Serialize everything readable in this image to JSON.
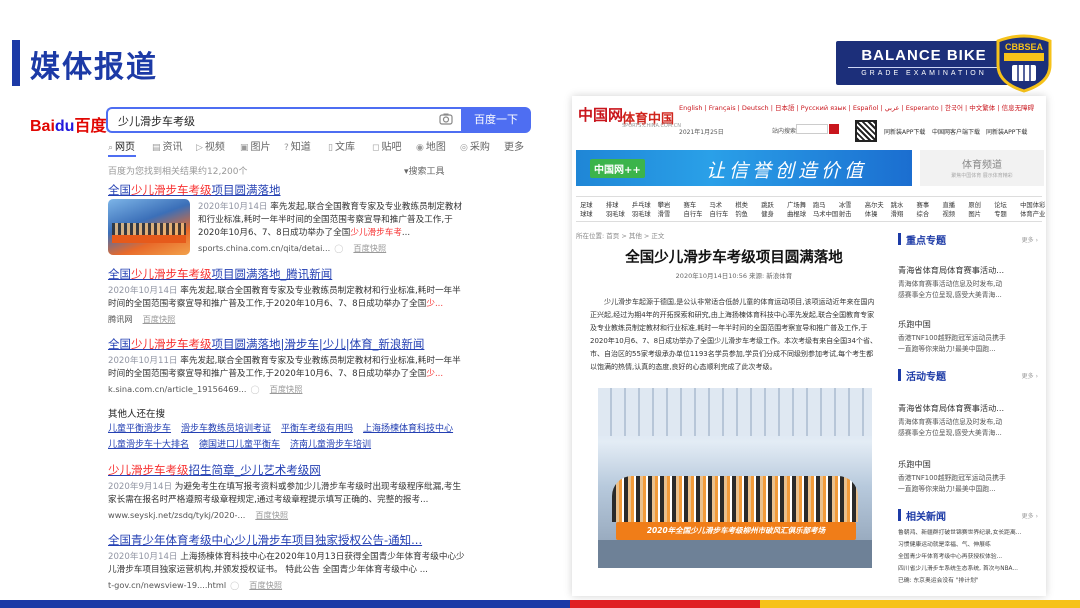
{
  "slide": {
    "title": "媒体报道",
    "brand": {
      "name": "BALANCE BIKE",
      "sub": "GRADE EXAMINATION",
      "badge": "CBBSEA"
    }
  },
  "baidu": {
    "logo_a": "Bai",
    "logo_b": "du",
    "logo_c": "百度",
    "query": "少儿滑步车考级",
    "search_button": "百度一下",
    "tabs": [
      "网页",
      "资讯",
      "视频",
      "图片",
      "知道",
      "文库",
      "贴吧",
      "地图",
      "采购",
      "更多"
    ],
    "result_count": "百度为您找到相关结果约12,200个",
    "tools": "搜索工具",
    "results": [
      {
        "title_pre": "全国",
        "title_em": "少儿滑步车考级",
        "title_post": "项目圆满落地",
        "date": "2020年10月14日",
        "snippet_a": " 率先发起,联合全国教育专家及专业教练员制定教材和行业标准,耗时一年半时间的全国范围考察宣导和推广普及工作,于2020年10月6、7、8日成功举办了全国",
        "snippet_em": "少儿滑步车考",
        "snippet_b": "...",
        "source": "sports.china.com.cn/qita/detai...",
        "kuaizhao": "百度快照"
      },
      {
        "title_pre": "全国",
        "title_em": "少儿滑步车考级",
        "title_post": "项目圆满落地_腾讯新闻",
        "date": "2020年10月14日",
        "snippet_a": " 率先发起,联合全国教育专家及专业教练员制定教材和行业标准,耗时一年半时间的全国范围考察宣导和推广普及工作,于2020年10月6、7、8日成功举办了全国",
        "snippet_em": "少...",
        "snippet_b": "",
        "source": "腾讯网",
        "kuaizhao": "百度快照"
      },
      {
        "title_pre": "全国",
        "title_em": "少儿滑步车考级",
        "title_post": "项目圆满落地|滑步车|少儿|体育_新浪新闻",
        "date": "2020年10月11日",
        "snippet_a": " 率先发起,联合全国教育专家及专业教练员制定教材和行业标准,耗时一年半时间的全国范围考察宣导和推广普及工作,于2020年10月6、7、8日成功举办了全国",
        "snippet_em": "少...",
        "snippet_b": "",
        "source": "k.sina.com.cn/article_19156469...",
        "kuaizhao": "百度快照"
      }
    ],
    "others": {
      "heading": "其他人还在搜",
      "row1": [
        "儿童平衡滑步车",
        "滑步车教练员培训考证",
        "平衡车考级有用吗",
        "上海扬楝体育科技中心"
      ],
      "row2": [
        "儿童滑步车十大排名",
        "德国进口儿童平衡车",
        "济南儿童滑步车培训"
      ]
    },
    "results2": [
      {
        "title_em": "少儿滑步车考级",
        "title_post": "招生简章_少儿艺术考级网",
        "date": "2020年9月14日",
        "snippet": " 为避免考生在填写报考资料或参加少儿滑步车考级时出现考级程序纰漏,考生家长需在报名时严格遵照考级章程规定,通过考级章程提示填写正确的、完整的报考...",
        "source": "www.seyskj.net/zsdq/tykj/2020-...",
        "kuaizhao": "百度快照"
      },
      {
        "title": "全国青少年体育考级中心少儿滑步车项目独家授权公告-通知...",
        "date": "2020年10月14日",
        "snippet": " 上海扬楝体育科技中心在2020年10月13日获得全国青少年体育考级中心少儿滑步车项目独家运营机构,并颁发授权证书。 特此公告 全国青少年体育考级中心 ...",
        "source": "t-gov.cn/newsview-19....html",
        "kuaizhao": "百度快照"
      }
    ]
  },
  "sports": {
    "logo_main": "中国网",
    "logo_site": "体育中国",
    "logo_site_sub": "SPORTS.CHINA.COM.CN",
    "langs": "English | Français | Deutsch | 日本語 | Русский язык | Español | عربي | Esperanto | 한국어 | 中文繁体 | 信息无障碍",
    "date": "2021年1月25日",
    "site_search": "站内搜索",
    "apps": [
      "同新装APP下载",
      "中国网客户端下载",
      "同新装APP下载"
    ],
    "banner_logo": "中国网++",
    "banner_text": "让信誉创造价值",
    "side_banner_title": "体育频道",
    "side_banner_sub": "聚焦中国体育 展示体育精彩",
    "nav": [
      [
        "足球",
        "球球"
      ],
      [
        "排球",
        "羽毛球"
      ],
      [
        "乒乓球",
        "羽毛球"
      ],
      [
        "攀岩",
        "滑雪"
      ],
      [
        "赛车",
        "自行车"
      ],
      [
        "马术",
        "自行车"
      ],
      [
        "棋类",
        "钓鱼"
      ],
      [
        "跳跃",
        "健身"
      ],
      [
        "广场舞",
        "曲棍球"
      ],
      [
        "跑马",
        "马术中国"
      ],
      [
        "冰雪",
        "射击"
      ],
      [
        "高尔夫",
        "体操"
      ],
      [
        "跳水",
        "滑翔"
      ],
      [
        "赛事",
        "综合"
      ],
      [
        "直播",
        "视频"
      ],
      [
        "原创",
        "图片"
      ],
      [
        "论坛",
        "专题"
      ],
      [
        "中国体彩",
        "体育产业"
      ]
    ],
    "crumb": "所在位置: 首页 > 其他 > 正文",
    "article_title": "全国少儿滑步车考级项目圆满落地",
    "meta": "2020年10月14日10:56    来源: 新浪体育",
    "paragraph": "少儿滑步车起源于德国,是公认非常适合低龄儿童的体育运动项目,该项运动近年来在国内正兴起,经过为期4年的开拓探索和研究,由上海扬楝体育科技中心率先发起,联合全国教育专家及专业教练员制定教材和行业标准,耗时一年半时间的全国范围考察宣导和推广普及工作,于2020年10月6、7、8日成功举办了全国少儿滑步车考级工作。本次考级有来自全国34个省、市、自治区的55家考级承办单位1193名学员参加,学员们分成不同级别参加考试,每个考生都以饱满的热情,认真的态度,良好的心态顺利完成了此次考级。",
    "photo_banner": "2020年全国少儿滑步车考级柳州市破风汇俱乐部考场",
    "side": {
      "focus_head": "重点专题",
      "focus_more": "更多",
      "focus_items": [
        {
          "h": "青海省体育局体育赛事活动...",
          "d1": "青海体育赛事活动信息及时发布,动",
          "d2": "感赛事全方位呈现,感受大美青海..."
        },
        {
          "h": "乐跑中国",
          "d1": "香港TNF100越野跑冠军运动员携手",
          "d2": "一直跑等你来助力!最美中国跑..."
        }
      ],
      "activity_head": "活动专题",
      "activity_more": "更多",
      "activity_items": [
        {
          "h": "青海省体育局体育赛事活动...",
          "d1": "青海体育赛事活动信息及时发布,动",
          "d2": "感赛事全方位呈现,感受大美青海..."
        },
        {
          "h": "乐跑中国",
          "d1": "香港TNF100越野跑冠军运动员携手",
          "d2": "一直跑等你来助力!最美中国跑..."
        }
      ],
      "news_head": "相关新闻",
      "news_more": "更多",
      "news": [
        "鲁朝鸿、新疆群打破世锦赛世界纪录,女长距离...",
        "习惯健康运动就是幸福、气、伸展练",
        "全国青少年体育考级中心再获授权体验...",
        "四川省少儿滑步车系统生态系统, 首次与NBA...",
        "已确: 东京奥运会没有 \"排计划\""
      ]
    }
  },
  "colors": {
    "accent": "#1c3aa6",
    "red": "#e02024",
    "yellow": "#f6c21a",
    "baidu_blue": "#4e6ef2",
    "link": "#2440b3",
    "highlight": "#f73131"
  }
}
